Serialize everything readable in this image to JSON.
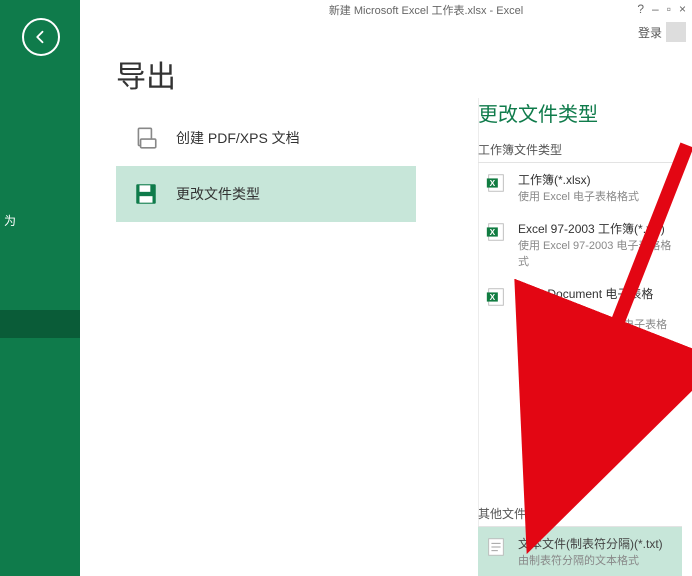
{
  "window": {
    "title": "新建 Microsoft Excel 工作表.xlsx - Excel",
    "help": "?",
    "min": "–",
    "restore": "▫",
    "close": "×",
    "signin": "登录"
  },
  "nav": {
    "item_a": "为"
  },
  "page": {
    "title": "导出"
  },
  "left_options": {
    "pdf": "创建 PDF/XPS 文档",
    "change": "更改文件类型"
  },
  "right": {
    "heading": "更改文件类型",
    "workbook_section": "工作簿文件类型",
    "other_section": "其他文件类型",
    "types": {
      "xlsx_name": "工作簿(*.xlsx)",
      "xlsx_desc": "使用 Excel 电子表格格式",
      "xls_name": "Excel 97-2003 工作簿(*.xls)",
      "xls_desc": "使用 Excel 97-2003 电子表格格式",
      "ods_name": "OpenDocument 电子表格(*.ods)",
      "ods_desc": "使用 OpenDocument 电子表格格式",
      "txt_name": "文本文件(制表符分隔)(*.txt)",
      "txt_desc": "由制表符分隔的文本格式"
    }
  }
}
